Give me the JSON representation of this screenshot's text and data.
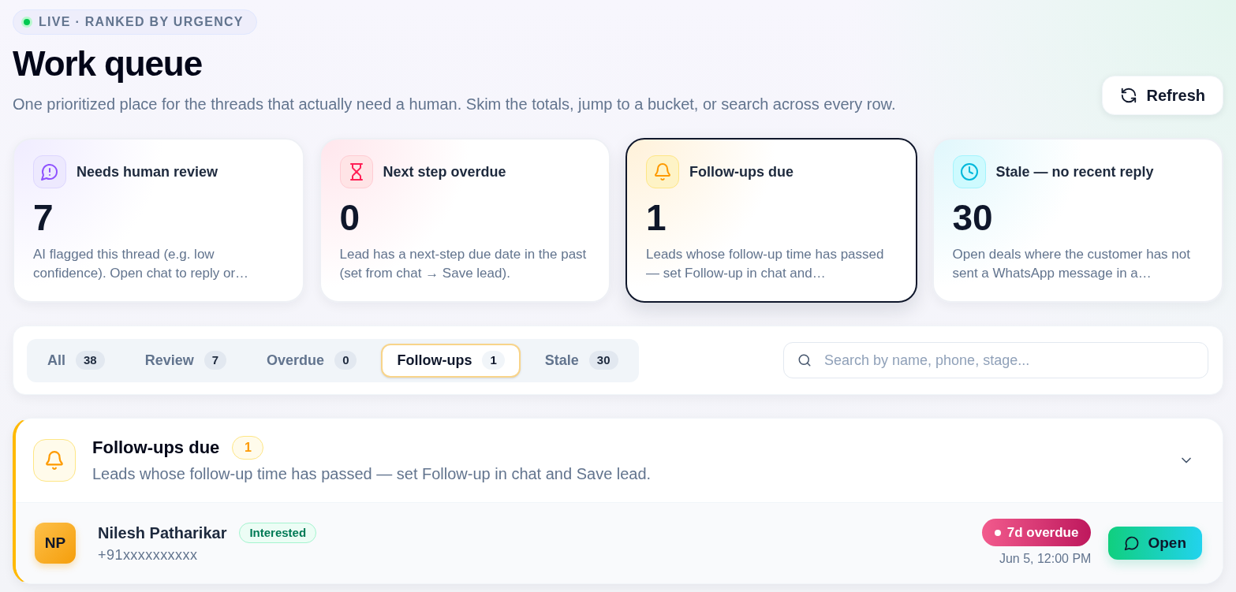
{
  "live_badge": {
    "label": "LIVE · RANKED BY URGENCY"
  },
  "header": {
    "title": "Work queue",
    "subtitle": "One prioritized place for the threads that actually need a human. Skim the totals, jump to a bucket, or search across every row.",
    "refresh_button": "Refresh"
  },
  "summary_cards": [
    {
      "kind": "review",
      "title": "Needs human review",
      "count": "7",
      "description": "AI flagged this thread (e.g. low confidence). Open chat to reply or…",
      "selected": false
    },
    {
      "kind": "overdue",
      "title": "Next step overdue",
      "count": "0",
      "description": "Lead has a next-step due date in the past (set from chat → Save lead).",
      "selected": false
    },
    {
      "kind": "followup",
      "title": "Follow-ups due",
      "count": "1",
      "description": "Leads whose follow-up time has passed — set Follow-up in chat and…",
      "selected": true
    },
    {
      "kind": "stale",
      "title": "Stale — no recent reply",
      "count": "30",
      "description": "Open deals where the customer has not sent a WhatsApp message in a…",
      "selected": false
    }
  ],
  "filter_tabs": [
    {
      "label": "All",
      "count": "38",
      "selected": false
    },
    {
      "label": "Review",
      "count": "7",
      "selected": false
    },
    {
      "label": "Overdue",
      "count": "0",
      "selected": false
    },
    {
      "label": "Follow-ups",
      "count": "1",
      "selected": true
    },
    {
      "label": "Stale",
      "count": "30",
      "selected": false
    }
  ],
  "search": {
    "placeholder": "Search by name, phone, stage..."
  },
  "bucket": {
    "kind": "followup",
    "title": "Follow-ups due",
    "count": "1",
    "description": "Leads whose follow-up time has passed — set Follow-up in chat and Save lead.",
    "expanded": true,
    "leads": [
      {
        "initials": "NP",
        "name": "Nilesh Patharikar",
        "stage": "Interested",
        "phone": "+91xxxxxxxxxx",
        "due": "7d overdue",
        "due_time": "Jun 5, 12:00 PM",
        "action": "Open"
      }
    ]
  }
}
